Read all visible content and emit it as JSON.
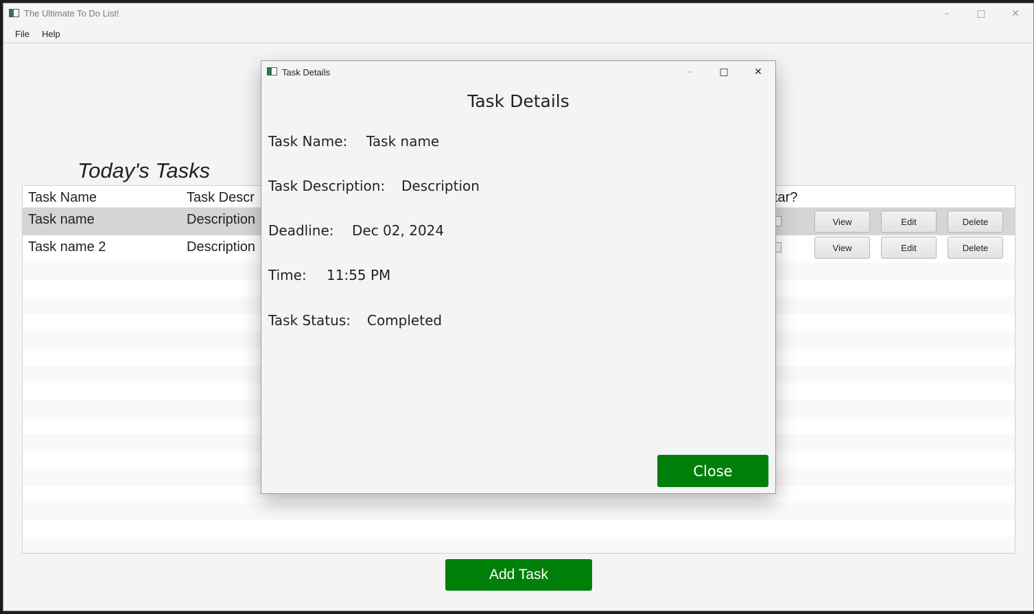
{
  "main": {
    "title": "The Ultimate To Do List!",
    "menu": [
      "File",
      "Help"
    ],
    "heading": "Today's Tasks",
    "columns": {
      "name": "Task Name",
      "description": "Task Descr",
      "star": "tar?"
    },
    "rows": [
      {
        "name": "Task name",
        "description": "Description",
        "selected": true
      },
      {
        "name": "Task name 2",
        "description": "Description",
        "selected": false
      }
    ],
    "buttons": {
      "view": "View",
      "edit": "Edit",
      "delete": "Delete"
    },
    "add_task": "Add Task"
  },
  "dialog": {
    "title": "Task Details",
    "heading": "Task Details",
    "fields": {
      "name_label": "Task Name:",
      "name_value": "Task name",
      "description_label": "Task Description:",
      "description_value": "Description",
      "deadline_label": "Deadline:",
      "deadline_value": "Dec 02, 2024",
      "time_label": "Time:",
      "time_value": "11:55 PM",
      "status_label": "Task Status:",
      "status_value": "Completed"
    },
    "close": "Close"
  },
  "colors": {
    "accent_green": "#00800a",
    "selected_row": "#d5d5d5"
  }
}
